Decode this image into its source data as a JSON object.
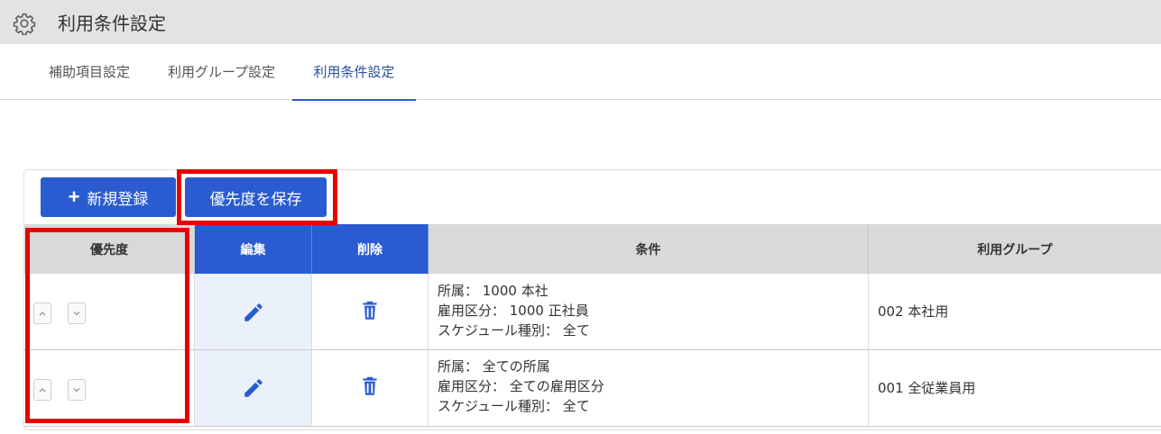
{
  "header": {
    "title": "利用条件設定",
    "icon": "gear-icon"
  },
  "tabs": [
    {
      "label": "補助項目設定",
      "active": false
    },
    {
      "label": "利用グループ設定",
      "active": false
    },
    {
      "label": "利用条件設定",
      "active": true
    }
  ],
  "toolbar": {
    "new_label": "新規登録",
    "save_priority_label": "優先度を保存"
  },
  "table": {
    "headers": {
      "priority": "優先度",
      "edit": "編集",
      "delete": "削除",
      "condition": "条件",
      "group": "利用グループ"
    },
    "rows": [
      {
        "condition_lines": [
          "所属： 1000 本社",
          "雇用区分： 1000 正社員",
          "スケジュール種別： 全て"
        ],
        "group": "002 本社用"
      },
      {
        "condition_lines": [
          "所属： 全ての所属",
          "雇用区分： 全ての雇用区分",
          "スケジュール種別： 全て"
        ],
        "group": "001 全従業員用"
      }
    ]
  },
  "colors": {
    "accent": "#2a5bd0",
    "highlight": "#e60000",
    "header_gray": "#d9d9d9",
    "edit_column_bg": "#eaf1fb"
  }
}
